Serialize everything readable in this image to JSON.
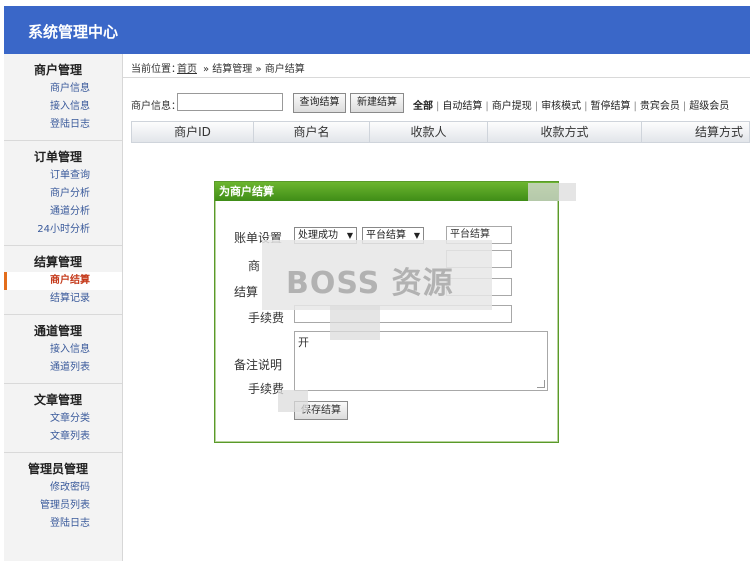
{
  "header": {
    "app_title": "系统管理中心"
  },
  "sidebar": {
    "groups": [
      {
        "title": "商户管理",
        "items": [
          "商户信息",
          "接入信息",
          "登陆日志"
        ]
      },
      {
        "title": "订单管理",
        "items": [
          "订单查询",
          "商户分析",
          "通道分析",
          "24小时分析"
        ]
      },
      {
        "title": "结算管理",
        "items": [
          "商户结算",
          "结算记录"
        ],
        "active_item": "商户结算"
      },
      {
        "title": "通道管理",
        "items": [
          "接入信息",
          "通道列表"
        ]
      },
      {
        "title": "文章管理",
        "items": [
          "文章分类",
          "文章列表"
        ]
      },
      {
        "title": "管理员管理",
        "items": [
          "修改密码",
          "管理员列表",
          "登陆日志"
        ]
      }
    ]
  },
  "breadcrumb": {
    "label": "当前位置：",
    "home": "首页",
    "rest": "» 结算管理 » 商户结算"
  },
  "filter": {
    "label": "商户信息：",
    "input_value": "",
    "query_button": "查询结算",
    "new_button": "新建结算",
    "links": [
      "全部",
      "自动结算",
      "商户提现",
      "审核模式",
      "暂停结算",
      "贵宾会员",
      "超级会员"
    ]
  },
  "table": {
    "columns": [
      "商户ID",
      "商户名",
      "收款人",
      "收款方式",
      "结算方式"
    ]
  },
  "dialog": {
    "title": "为商户结算",
    "labels": {
      "account": "账单设置",
      "merchant": "商",
      "settle": "结算",
      "fee": "手续费",
      "remark": "备注说明",
      "fee2": "手续费"
    },
    "select_status": "处理成功",
    "select_mode": "平台结算",
    "input_mode": "平台结算",
    "textarea_inner": "开",
    "save_button": "保存结算"
  },
  "watermark": {
    "text": "BOSS 资源"
  },
  "colors": {
    "header_bg": "#3a67c8",
    "dialog_title": "#4f9f20",
    "active_marker": "#e36d1b"
  }
}
